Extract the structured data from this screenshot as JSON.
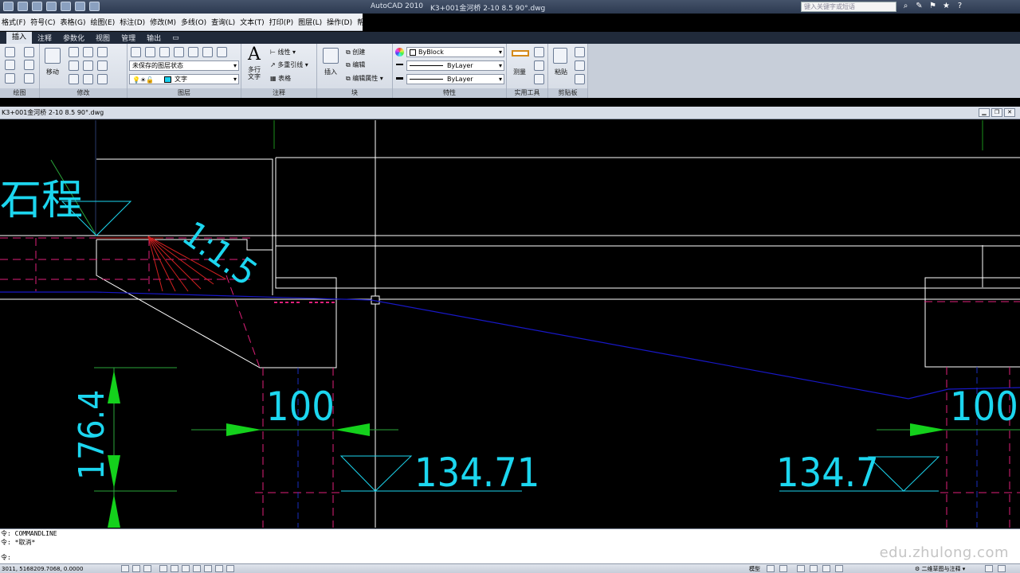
{
  "app": {
    "title": "AutoCAD 2010",
    "file_title": "K3+001金河桥 2-10 8.5 90°.dwg",
    "search_placeholder": "键入关键字或短语"
  },
  "menu": [
    "格式(F)",
    "符号(C)",
    "表格(G)",
    "绘图(E)",
    "标注(D)",
    "修改(M)",
    "多线(O)",
    "查询(L)",
    "文本(T)",
    "打印(P)",
    "图层(L)",
    "操作(D)",
    "帮助(H)"
  ],
  "ribbon_tabs": [
    "插入",
    "注释",
    "参数化",
    "视图",
    "管理",
    "输出"
  ],
  "ribbon": {
    "panels": {
      "draw": "绘图",
      "modify": "修改",
      "layers": "图层",
      "annotation": "注释",
      "block": "块",
      "properties": "特性",
      "utilities": "实用工具",
      "clipboard": "剪贴板"
    },
    "move_label": "移动",
    "layer_state": "未保存的图层状态",
    "layer_current": "文字",
    "mtext_label": "多行\n文字",
    "linear_label": "线性",
    "multileader_label": "多重引线",
    "table_label": "表格",
    "insert_label": "插入",
    "create_label": "创建",
    "edit_label": "编辑",
    "edit_attr_label": "编辑属性",
    "color_value": "ByBlock",
    "linetype_value": "ByLayer",
    "lineweight_value": "ByLayer",
    "measure_label": "测量",
    "paste_label": "粘贴"
  },
  "document_tab": "K3+001金河桥 2-10 8.5 90°.dwg",
  "drawing": {
    "heading_text": "石程",
    "slope_text": "1:1.5",
    "dim_vertical": "176.4",
    "dim_width_left": "100",
    "dim_width_right": "100",
    "elevation_left": "134.71",
    "elevation_right": "134.7"
  },
  "command_line": {
    "history_1": "令: COMMANDLINE",
    "history_2": "令: *取消*",
    "prompt": "令:"
  },
  "watermark": "edu.zhulong.com",
  "status": {
    "coordinates": "3011, 5168209.7068, 0.0000",
    "model_label": "模型",
    "workspace": "二维草图与注释"
  }
}
